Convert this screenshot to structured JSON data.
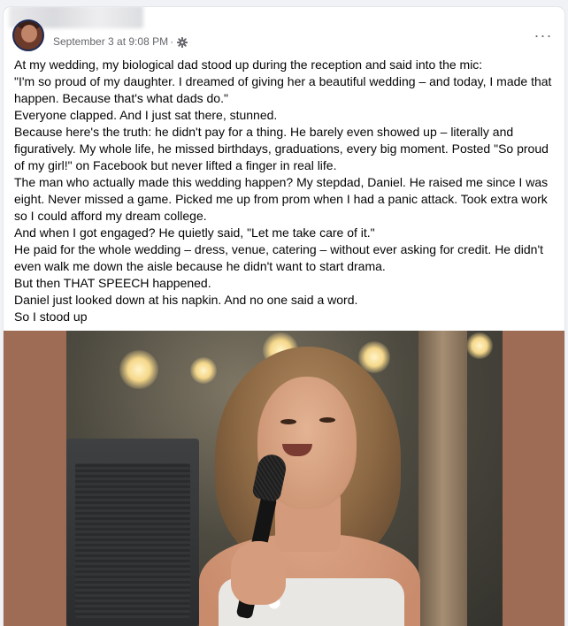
{
  "post": {
    "timestamp": "September 3 at 9:08 PM",
    "separator": "·",
    "more_label": "···",
    "paragraphs": [
      "At my wedding, my biological dad stood up during the reception and said into the mic:",
      "\"I'm so proud of my daughter. I dreamed of giving her a beautiful wedding – and today, I made that happen. Because that's what dads do.\"",
      "Everyone clapped. And I just sat there, stunned.",
      "Because here's the truth: he didn't pay for a thing. He barely even showed up – literally and figuratively. My whole life, he missed birthdays, graduations, every big moment. Posted \"So proud of my girl!\" on Facebook but never lifted a finger in real life.",
      "The man who actually made this wedding happen? My stepdad, Daniel. He raised me since I was eight. Never missed a game. Picked me up from prom when I had a panic attack. Took extra work so I could afford my dream college.",
      "And when I got engaged? He quietly said, \"Let me take care of it.\"",
      "He paid for the whole wedding – dress, venue, catering – without ever asking for credit. He didn't even walk me down the aisle because he didn't want to start drama.",
      "But then THAT SPEECH happened.",
      "Daniel just looked down at his napkin. And no one said a word.",
      "So I stood up"
    ]
  },
  "icons": {
    "audience": "gear-icon",
    "more": "more-options-icon"
  },
  "colors": {
    "background": "#f0f2f5",
    "card": "#ffffff",
    "text": "#050505",
    "meta": "#65676b",
    "media_backdrop": "#9e6c55"
  }
}
